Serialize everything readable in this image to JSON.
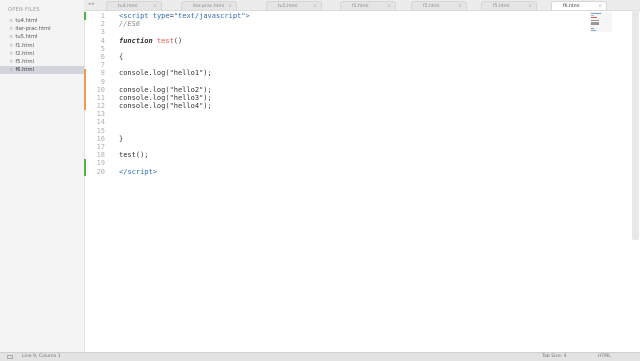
{
  "sidebar": {
    "header": "OPEN FILES",
    "items": [
      {
        "label": "tu4.html"
      },
      {
        "label": "iter-prac.html"
      },
      {
        "label": "tu5.html"
      },
      {
        "label": "f1.html"
      },
      {
        "label": "f2.html"
      },
      {
        "label": "f5.html"
      },
      {
        "label": "f6.html"
      }
    ]
  },
  "tabbar": {
    "nav": "◂ ▸",
    "tabs": [
      {
        "label": "tu4.html"
      },
      {
        "label": "iter-prac.html"
      },
      {
        "label": "tu5.html"
      },
      {
        "label": "f1.html"
      },
      {
        "label": "f2.html"
      },
      {
        "label": "f5.html"
      },
      {
        "label": "f6.html"
      }
    ],
    "close_glyph": "×"
  },
  "editor": {
    "line_numbers": [
      "1",
      "2",
      "3",
      "4",
      "5",
      "6",
      "7",
      "8",
      "9",
      "10",
      "11",
      "12",
      "13",
      "14",
      "15",
      "16",
      "17",
      "18",
      "19",
      "20"
    ],
    "lines": {
      "l1a": "<",
      "l1b": "script",
      "l1c": " ",
      "l1d": "type",
      "l1e": "=",
      "l1f": "\"text/javascript\"",
      "l1g": ">",
      "l2": "//ES6",
      "l4a": "function",
      "l4b": " ",
      "l4c": "test",
      "l4d": "()",
      "l6": "{",
      "l8": "console.log(\"hello1\");",
      "l10": "console.log(\"hello2\");",
      "l11": "console.log(\"hello3\");",
      "l12": "console.log(\"hello4\");",
      "l16": "}",
      "l18": "test();",
      "l20a": "</",
      "l20b": "script",
      "l20c": ">"
    },
    "colors": {
      "tag": "#2b6cb0",
      "attr": "#2b6cb0",
      "string": "#2b6cb0",
      "comment": "#8a8a8a",
      "keyword": "#333333",
      "function_name": "#e0584a",
      "added_marker": "#55b04a",
      "modified_marker": "#ef9a4f"
    }
  },
  "statusbar": {
    "position": "Line 9, Column 1",
    "tab_size": "Tab Size: 4",
    "syntax": "HTML"
  }
}
